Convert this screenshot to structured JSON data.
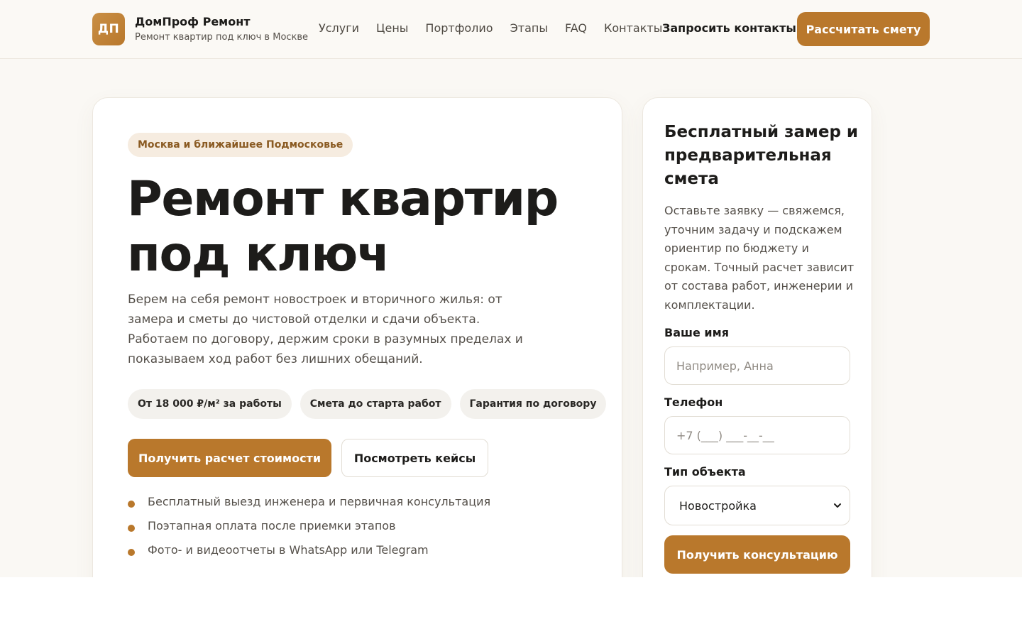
{
  "header": {
    "logo_text": "ДП",
    "brand_name": "ДомПроф Ремонт",
    "brand_subtitle": "Ремонт квартир под ключ в Москве",
    "nav": [
      "Услуги",
      "Цены",
      "Портфолио",
      "Этапы",
      "FAQ",
      "Контакты"
    ],
    "request_contacts": "Запросить контакты",
    "cta": "Рассчитать смету"
  },
  "hero": {
    "tag": "Москва и ближайшее Подмосковье",
    "title_line1": "Ремонт квартир",
    "title_line2": "под ключ",
    "lead": "Берем на себя ремонт новостроек и вторичного жилья: от замера и сметы до чистовой отделки и сдачи объекта. Работаем по договору, держим сроки в разумных пределах и показываем ход работ без лишних обещаний.",
    "chips": [
      "От 18 000 ₽/м² за работы",
      "Смета до старта работ",
      "Гарантия по договору"
    ],
    "primary_button": "Получить расчет стоимости",
    "secondary_button": "Посмотреть кейсы",
    "bullets": [
      "Бесплатный выезд инженера и первичная консультация",
      "Поэтапная оплата после приемки этапов",
      "Фото- и видеоотчеты в WhatsApp или Telegram"
    ]
  },
  "form": {
    "title": "Бесплатный замер и предварительная смета",
    "description": "Оставьте заявку — свяжемся, уточним задачу и подскажем ориентир по бюджету и срокам. Точный расчет зависит от состава работ, инженерии и комплектации.",
    "name_label": "Ваше имя",
    "name_placeholder": "Например, Анна",
    "phone_label": "Телефон",
    "phone_placeholder": "+7 (___) ___-__-__",
    "type_label": "Тип объекта",
    "type_value": "Новостройка",
    "submit": "Получить консультацию"
  },
  "colors": {
    "accent": "#b9782c",
    "background": "#faf8f4",
    "tag_background": "#f6ece0",
    "chip_background": "#f3f1ed"
  }
}
